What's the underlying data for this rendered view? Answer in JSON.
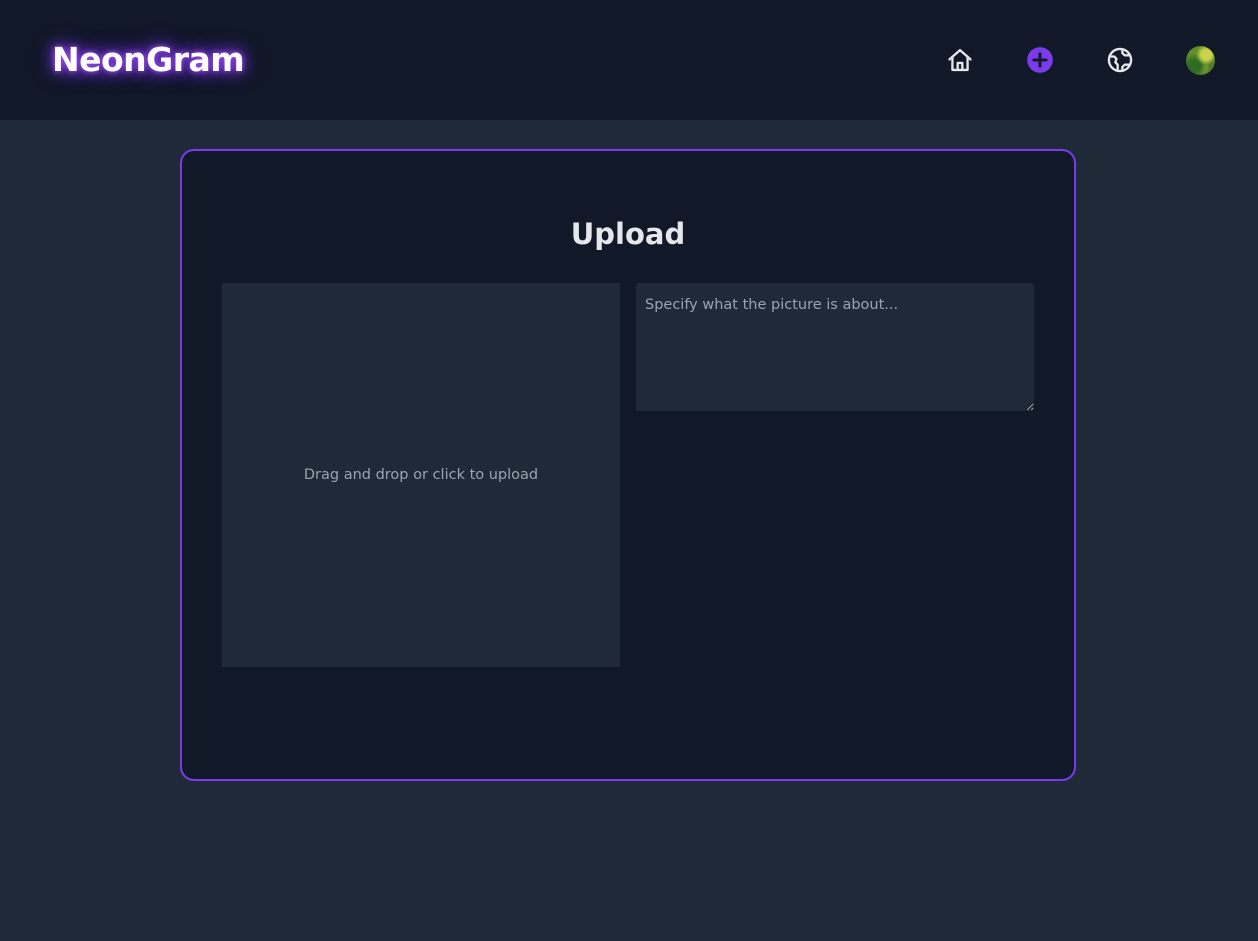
{
  "header": {
    "brand": "NeonGram",
    "nav": [
      {
        "name": "home",
        "icon": "home-icon",
        "active": false
      },
      {
        "name": "upload",
        "icon": "plus-circle-icon",
        "active": true
      },
      {
        "name": "explore",
        "icon": "globe-icon",
        "active": false
      },
      {
        "name": "profile",
        "icon": "avatar",
        "active": false
      }
    ]
  },
  "upload": {
    "title": "Upload",
    "dropzone_text": "Drag and drop or click to upload",
    "caption_value": "",
    "caption_placeholder": "Specify what the picture is about..."
  },
  "colors": {
    "accent": "#7c3aed",
    "page_bg": "#1f2937",
    "panel_bg": "#111827",
    "muted_text": "#9ca3af"
  }
}
